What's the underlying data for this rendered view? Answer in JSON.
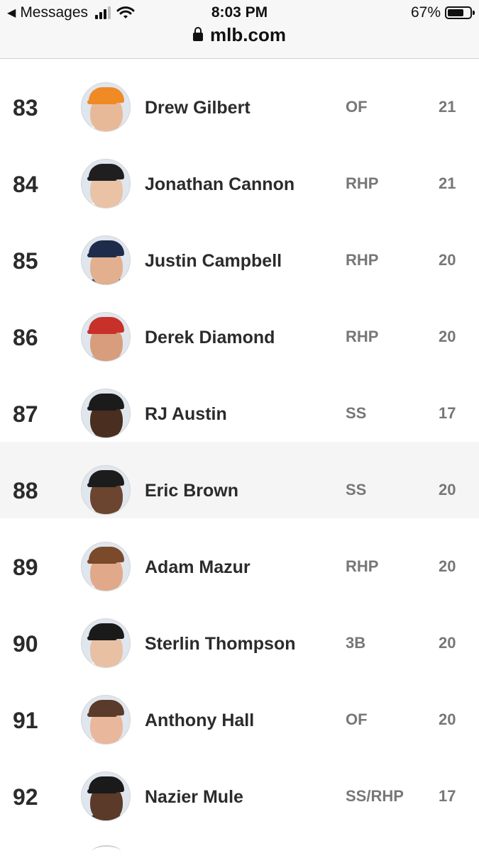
{
  "status_bar": {
    "back_label": "Messages",
    "time": "8:03 PM",
    "battery": "67%",
    "url": "mlb.com"
  },
  "players": [
    {
      "rank": "83",
      "name": "Drew Gilbert",
      "pos": "OF",
      "age": "21",
      "skin": "#e8b999",
      "cap": "#f08a24",
      "shirt": "#ffffff"
    },
    {
      "rank": "84",
      "name": "Jonathan Cannon",
      "pos": "RHP",
      "age": "21",
      "skin": "#eac2a6",
      "cap": "#1f1f1f",
      "shirt": "#ffffff"
    },
    {
      "rank": "85",
      "name": "Justin Campbell",
      "pos": "RHP",
      "age": "20",
      "skin": "#e2b08e",
      "cap": "#1f2b4a",
      "shirt": "#1f2b4a"
    },
    {
      "rank": "86",
      "name": "Derek Diamond",
      "pos": "RHP",
      "age": "20",
      "skin": "#d79d7c",
      "cap": "#c8302a",
      "shirt": "#a9c8e8"
    },
    {
      "rank": "87",
      "name": "RJ Austin",
      "pos": "SS",
      "age": "17",
      "skin": "#4a2e1f",
      "cap": "#1b1b1b",
      "shirt": "#ffffff"
    },
    {
      "rank": "88",
      "name": "Eric Brown",
      "pos": "SS",
      "age": "20",
      "skin": "#6b452f",
      "cap": "#1c1c1c",
      "shirt": "#ffffff"
    },
    {
      "rank": "89",
      "name": "Adam Mazur",
      "pos": "RHP",
      "age": "20",
      "skin": "#e1a98a",
      "cap": "#7a4a2a",
      "shirt": "#ffffff"
    },
    {
      "rank": "90",
      "name": "Sterlin Thompson",
      "pos": "3B",
      "age": "20",
      "skin": "#e8c0a4",
      "cap": "#1a1a1a",
      "shirt": "#ffffff"
    },
    {
      "rank": "91",
      "name": "Anthony Hall",
      "pos": "OF",
      "age": "20",
      "skin": "#e9b79b",
      "cap": "#5a3a2a",
      "shirt": "#ffffff"
    },
    {
      "rank": "92",
      "name": "Nazier Mule",
      "pos": "SS/RHP",
      "age": "17",
      "skin": "#5b3a29",
      "cap": "#1a1a1a",
      "shirt": "#1c2a40"
    }
  ],
  "highlighted_index": 5
}
